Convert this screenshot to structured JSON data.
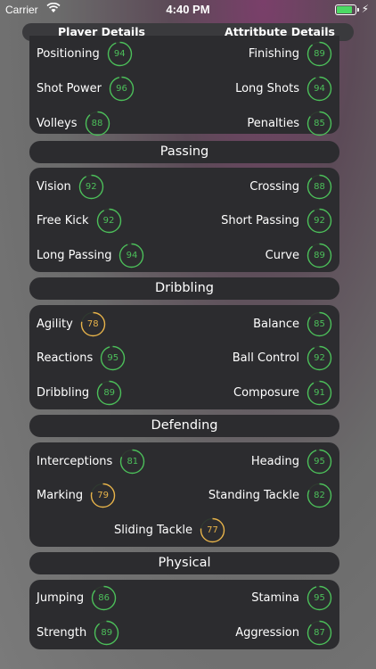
{
  "status": {
    "carrier": "Carrier",
    "time": "4:40 PM"
  },
  "tabs": {
    "left": "Player Details",
    "right": "Attritbute Details"
  },
  "colors": {
    "green": "#4cbf5a",
    "yellow": "#e8b34a"
  },
  "sections": {
    "shooting": {
      "rows": [
        {
          "left": {
            "label": "Positioning",
            "value": "94",
            "color": "green"
          },
          "right": {
            "label": "Finishing",
            "value": "89",
            "color": "green"
          }
        },
        {
          "left": {
            "label": "Shot Power",
            "value": "96",
            "color": "green"
          },
          "right": {
            "label": "Long Shots",
            "value": "94",
            "color": "green"
          }
        },
        {
          "left": {
            "label": "Volleys",
            "value": "88",
            "color": "green"
          },
          "right": {
            "label": "Penalties",
            "value": "85",
            "color": "green"
          }
        }
      ]
    },
    "passing": {
      "title": "Passing",
      "rows": [
        {
          "left": {
            "label": "Vision",
            "value": "92",
            "color": "green"
          },
          "right": {
            "label": "Crossing",
            "value": "88",
            "color": "green"
          }
        },
        {
          "left": {
            "label": "Free Kick",
            "value": "92",
            "color": "green"
          },
          "right": {
            "label": "Short Passing",
            "value": "92",
            "color": "green"
          }
        },
        {
          "left": {
            "label": "Long Passing",
            "value": "94",
            "color": "green"
          },
          "right": {
            "label": "Curve",
            "value": "89",
            "color": "green"
          }
        }
      ]
    },
    "dribbling": {
      "title": "Dribbling",
      "rows": [
        {
          "left": {
            "label": "Agility",
            "value": "78",
            "color": "yellow"
          },
          "right": {
            "label": "Balance",
            "value": "85",
            "color": "green"
          }
        },
        {
          "left": {
            "label": "Reactions",
            "value": "95",
            "color": "green"
          },
          "right": {
            "label": "Ball Control",
            "value": "92",
            "color": "green"
          }
        },
        {
          "left": {
            "label": "Dribbling",
            "value": "89",
            "color": "green"
          },
          "right": {
            "label": "Composure",
            "value": "91",
            "color": "green"
          }
        }
      ]
    },
    "defending": {
      "title": "Defending",
      "rows": [
        {
          "left": {
            "label": "Interceptions",
            "value": "81",
            "color": "green"
          },
          "right": {
            "label": "Heading",
            "value": "95",
            "color": "green"
          }
        },
        {
          "left": {
            "label": "Marking",
            "value": "79",
            "color": "yellow"
          },
          "right": {
            "label": "Standing Tackle",
            "value": "82",
            "color": "green"
          }
        },
        {
          "center": {
            "label": "Sliding Tackle",
            "value": "77",
            "color": "yellow"
          }
        }
      ]
    },
    "physical": {
      "title": "Physical",
      "rows": [
        {
          "left": {
            "label": "Jumping",
            "value": "86",
            "color": "green"
          },
          "right": {
            "label": "Stamina",
            "value": "95",
            "color": "green"
          }
        },
        {
          "left": {
            "label": "Strength",
            "value": "89",
            "color": "green"
          },
          "right": {
            "label": "Aggression",
            "value": "87",
            "color": "green"
          }
        }
      ]
    }
  }
}
